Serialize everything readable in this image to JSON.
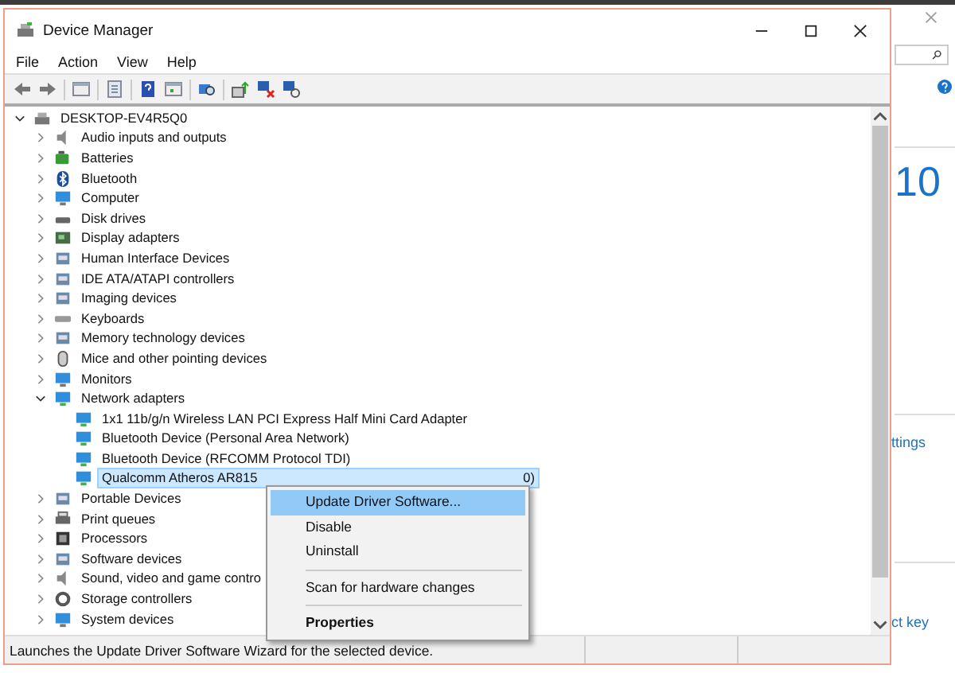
{
  "window": {
    "title": "Device Manager"
  },
  "menu_bar": [
    "File",
    "Action",
    "View",
    "Help"
  ],
  "tree": {
    "root": {
      "label": "DESKTOP-EV4R5Q0",
      "expanded": true,
      "selected": false,
      "children": [
        {
          "label": "Audio inputs and outputs",
          "expanded": false,
          "selected": false
        },
        {
          "label": "Batteries",
          "expanded": false,
          "selected": false
        },
        {
          "label": "Bluetooth",
          "expanded": false,
          "selected": false
        },
        {
          "label": "Computer",
          "expanded": false,
          "selected": false
        },
        {
          "label": "Disk drives",
          "expanded": false,
          "selected": false
        },
        {
          "label": "Display adapters",
          "expanded": false,
          "selected": false
        },
        {
          "label": "Human Interface Devices",
          "expanded": false,
          "selected": false
        },
        {
          "label": "IDE ATA/ATAPI controllers",
          "expanded": false,
          "selected": false
        },
        {
          "label": "Imaging devices",
          "expanded": false,
          "selected": false
        },
        {
          "label": "Keyboards",
          "expanded": false,
          "selected": false
        },
        {
          "label": "Memory technology devices",
          "expanded": false,
          "selected": false
        },
        {
          "label": "Mice and other pointing devices",
          "expanded": false,
          "selected": false
        },
        {
          "label": "Monitors",
          "expanded": false,
          "selected": false
        },
        {
          "label": "Network adapters",
          "expanded": true,
          "selected": false,
          "children": [
            {
              "label": "1x1 11b/g/n Wireless LAN PCI Express Half Mini Card Adapter",
              "selected": false
            },
            {
              "label": "Bluetooth Device (Personal Area Network)",
              "selected": false
            },
            {
              "label": "Bluetooth Device (RFCOMM Protocol TDI)",
              "selected": false
            },
            {
              "label": "Qualcomm Atheros AR815",
              "label_end": "0)",
              "selected": true
            }
          ]
        },
        {
          "label": "Portable Devices",
          "expanded": false,
          "selected": false
        },
        {
          "label": "Print queues",
          "expanded": false,
          "selected": false
        },
        {
          "label": "Processors",
          "expanded": false,
          "selected": false
        },
        {
          "label": "Software devices",
          "expanded": false,
          "selected": false
        },
        {
          "label": "Sound, video and game contro",
          "expanded": false,
          "selected": false
        },
        {
          "label": "Storage controllers",
          "expanded": false,
          "selected": false
        },
        {
          "label": "System devices",
          "expanded": false,
          "selected": false
        }
      ]
    }
  },
  "context_menu": {
    "items": [
      {
        "kind": "command",
        "label": "Update Driver Software...",
        "selected": true,
        "default": false
      },
      {
        "kind": "command",
        "label": "Disable",
        "selected": false,
        "default": false
      },
      {
        "kind": "command",
        "label": "Uninstall",
        "selected": false,
        "default": false
      },
      {
        "kind": "separator"
      },
      {
        "kind": "command",
        "label": "Scan for hardware changes",
        "selected": false,
        "default": false
      },
      {
        "kind": "separator"
      },
      {
        "kind": "command",
        "label": "Properties",
        "selected": false,
        "default": true
      }
    ]
  },
  "status_bar": {
    "text": "Launches the Update Driver Software Wizard for the selected device."
  },
  "background_window": {
    "heading": "10",
    "links": [
      "ttings",
      "ct key"
    ]
  }
}
